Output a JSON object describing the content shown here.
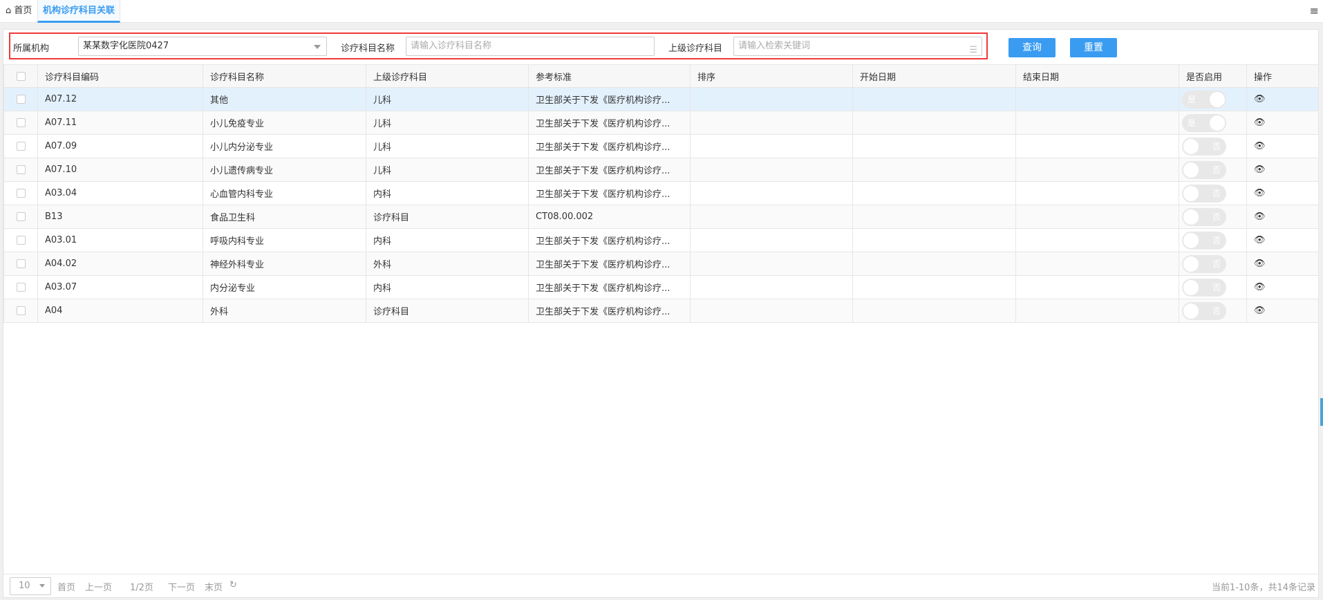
{
  "tabs": {
    "home_label": "首页",
    "active_label": "机构诊疗科目关联",
    "close": "×"
  },
  "filter": {
    "org_label": "所属机构",
    "org_value": "某某数字化医院0427",
    "name_label": "诊疗科目名称",
    "name_placeholder": "请输入诊疗科目名称",
    "parent_label": "上级诊疗科目",
    "parent_placeholder": "请输入检索关键词",
    "query": "查询",
    "reset": "重置"
  },
  "table": {
    "headers": [
      "诊疗科目编码",
      "诊疗科目名称",
      "上级诊疗科目",
      "参考标准",
      "排序",
      "开始日期",
      "结束日期",
      "是否启用",
      "操作"
    ],
    "rows": [
      {
        "code": "A07.12",
        "name": "其他",
        "parent": "儿科",
        "std": "卫生部关于下发《医疗机构诊疗...",
        "enabled": "是"
      },
      {
        "code": "A07.11",
        "name": "小儿免疫专业",
        "parent": "儿科",
        "std": "卫生部关于下发《医疗机构诊疗...",
        "enabled": "是"
      },
      {
        "code": "A07.09",
        "name": "小儿内分泌专业",
        "parent": "儿科",
        "std": "卫生部关于下发《医疗机构诊疗...",
        "enabled": "否"
      },
      {
        "code": "A07.10",
        "name": "小儿遗传病专业",
        "parent": "儿科",
        "std": "卫生部关于下发《医疗机构诊疗...",
        "enabled": "否"
      },
      {
        "code": "A03.04",
        "name": "心血管内科专业",
        "parent": "内科",
        "std": "卫生部关于下发《医疗机构诊疗...",
        "enabled": "否"
      },
      {
        "code": "B13",
        "name": "食品卫生科",
        "parent": "诊疗科目",
        "std": "CT08.00.002",
        "enabled": "否"
      },
      {
        "code": "A03.01",
        "name": "呼吸内科专业",
        "parent": "内科",
        "std": "卫生部关于下发《医疗机构诊疗...",
        "enabled": "否"
      },
      {
        "code": "A04.02",
        "name": "神经外科专业",
        "parent": "外科",
        "std": "卫生部关于下发《医疗机构诊疗...",
        "enabled": "否"
      },
      {
        "code": "A03.07",
        "name": "内分泌专业",
        "parent": "内科",
        "std": "卫生部关于下发《医疗机构诊疗...",
        "enabled": "否"
      },
      {
        "code": "A04",
        "name": "外科",
        "parent": "诊疗科目",
        "std": "卫生部关于下发《医疗机构诊疗...",
        "enabled": "否"
      }
    ]
  },
  "pager": {
    "page_size": "10",
    "first": "首页",
    "prev": "上一页",
    "current": "1/2页",
    "next": "下一页",
    "last": "末页",
    "info": "当前1-10条，共14条记录"
  }
}
